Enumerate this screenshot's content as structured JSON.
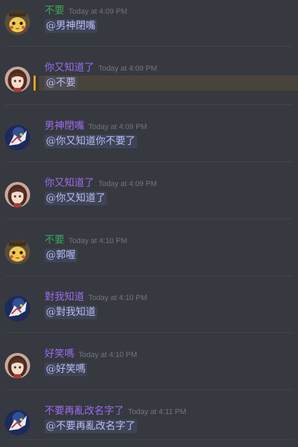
{
  "colors": {
    "background": "#36393f",
    "green_user": "#3ba55c",
    "purple_user": "#9a6cf0",
    "mention_text": "#b9bcf8",
    "timestamp": "#72767d",
    "highlight_bar": "#faa61a"
  },
  "messages": [
    {
      "username": "不要",
      "timestamp": "Today at 4:09 PM",
      "text": "@男神閉嘴",
      "avatar": "pikachu-detective-avatar"
    },
    {
      "username": "你又知道了",
      "timestamp": "Today at 4:09 PM",
      "text": "@不要",
      "avatar": "anime-girl-avatar",
      "highlighted": true
    },
    {
      "username": "男神閉嘴",
      "timestamp": "Today at 4:09 PM",
      "text": "@你又知道你不要了",
      "avatar": "mecha-avatar"
    },
    {
      "username": "你又知道了",
      "timestamp": "Today at 4:09 PM",
      "text": "@你又知道了",
      "avatar": "anime-girl-avatar"
    },
    {
      "username": "不要",
      "timestamp": "Today at 4:10 PM",
      "text": "@郭喔",
      "avatar": "pikachu-detective-avatar"
    },
    {
      "username": "對我知道",
      "timestamp": "Today at 4:10 PM",
      "text": "@對我知道",
      "avatar": "mecha-avatar"
    },
    {
      "username": "好笑嗎",
      "timestamp": "Today at 4:10 PM",
      "text": "@好笑嗎",
      "avatar": "anime-girl-avatar"
    },
    {
      "username": "不要再亂改名字了",
      "timestamp": "Today at 4:11 PM",
      "text": "@不要再亂改名字了",
      "avatar": "mecha-avatar"
    }
  ]
}
